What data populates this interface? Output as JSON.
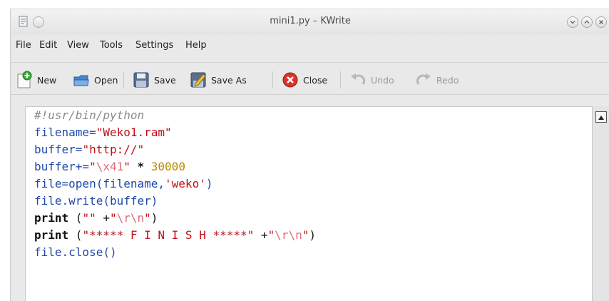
{
  "window": {
    "title": "mini1.py – KWrite"
  },
  "menubar": {
    "items": [
      {
        "label": "File"
      },
      {
        "label": "Edit"
      },
      {
        "label": "View"
      },
      {
        "label": "Tools"
      },
      {
        "label": "Settings"
      },
      {
        "label": "Help"
      }
    ]
  },
  "toolbar": {
    "new_label": "New",
    "open_label": "Open",
    "save_label": "Save",
    "saveas_label": "Save As",
    "close_label": "Close",
    "undo_label": "Undo",
    "redo_label": "Redo"
  },
  "editor": {
    "lines": [
      [
        {
          "t": "#!usr/bin/python"
        }
      ],
      [
        {
          "t": "filename="
        },
        {
          "t": "\"Weko1.ram\""
        }
      ],
      [
        {
          "t": "buffer="
        },
        {
          "t": "\"http://\""
        }
      ],
      [
        {
          "t": "buffer+="
        },
        {
          "t": "\""
        },
        {
          "t": "\\x41"
        },
        {
          "t": "\""
        },
        {
          "t": " * "
        },
        {
          "t": "30000"
        }
      ],
      [
        {
          "t": "file=open(filename,"
        },
        {
          "t": "'weko'"
        },
        {
          "t": ")"
        }
      ],
      [
        {
          "t": "file.write(buffer)"
        }
      ],
      [
        {
          "t": "print"
        },
        {
          "t": " ("
        },
        {
          "t": "\"\""
        },
        {
          "t": " +"
        },
        {
          "t": "\""
        },
        {
          "t": "\\r\\n"
        },
        {
          "t": "\""
        },
        {
          "t": ")"
        }
      ],
      [
        {
          "t": "print"
        },
        {
          "t": " ("
        },
        {
          "t": "\"***** F I N I S H *****\""
        },
        {
          "t": " +"
        },
        {
          "t": "\""
        },
        {
          "t": "\\r\\n"
        },
        {
          "t": "\""
        },
        {
          "t": ")"
        }
      ],
      [
        {
          "t": "file.close()"
        }
      ]
    ]
  },
  "colors": {
    "identifier": "#1f48a8",
    "string": "#c0101a",
    "escape": "#e06a7a",
    "number": "#b88a00",
    "comment": "#8a8a8a"
  }
}
